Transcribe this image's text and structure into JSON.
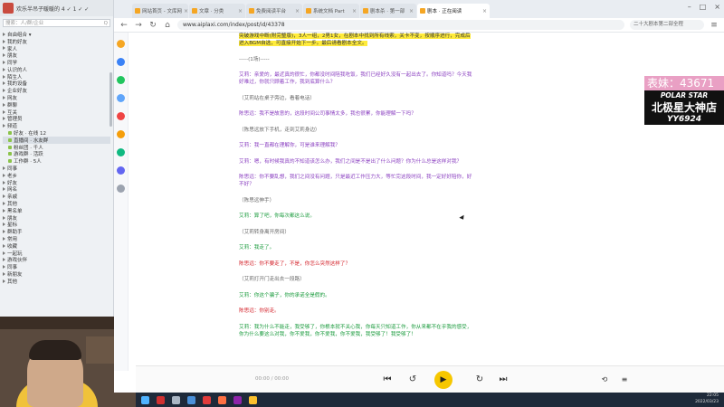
{
  "qq_panel": {
    "title": "欢乐半吊子暖暖的 4 ✓ 1 ✓ ✓",
    "search_placeholder": "搜索：人/群/企业",
    "search_scope": "Q",
    "items": [
      {
        "label": "自由组合 ▾",
        "sub": false
      },
      {
        "label": "我的好友",
        "sub": false
      },
      {
        "label": "家人",
        "sub": false
      },
      {
        "label": "朋友",
        "sub": false
      },
      {
        "label": "同学",
        "sub": false
      },
      {
        "label": "认识的人",
        "sub": false
      },
      {
        "label": "陌生人",
        "sub": false
      },
      {
        "label": "我的设备",
        "sub": false
      },
      {
        "label": "企业好友",
        "sub": false
      },
      {
        "label": "网友",
        "sub": false
      },
      {
        "label": "群聊",
        "sub": false
      },
      {
        "label": "互关",
        "sub": false
      },
      {
        "label": "管理员",
        "sub": false
      },
      {
        "label": "频道",
        "sub": false
      },
      {
        "label": "好友 · 在线 12",
        "sub": true,
        "sel": false
      },
      {
        "label": "直播间 · 水友群",
        "sub": true,
        "sel": true
      },
      {
        "label": "粉丝团 · 千人",
        "sub": true,
        "sel": false
      },
      {
        "label": "游戏群 · 活跃",
        "sub": true,
        "sel": false
      },
      {
        "label": "工作群 · 5人",
        "sub": true,
        "sel": false
      },
      {
        "label": "同事",
        "sub": false
      },
      {
        "label": "老乡",
        "sub": false
      },
      {
        "label": "好友",
        "sub": false
      },
      {
        "label": "网名",
        "sub": false
      },
      {
        "label": "亲戚",
        "sub": false
      },
      {
        "label": "其他",
        "sub": false
      },
      {
        "label": "黑名单",
        "sub": false
      },
      {
        "label": "朋友",
        "sub": false
      },
      {
        "label": "星标",
        "sub": false
      },
      {
        "label": "群助手",
        "sub": false
      },
      {
        "label": "常用",
        "sub": false
      },
      {
        "label": "收藏",
        "sub": false
      },
      {
        "label": "一起玩",
        "sub": false
      },
      {
        "label": "游戏伙伴",
        "sub": false
      },
      {
        "label": "同事",
        "sub": false
      },
      {
        "label": "新朋友",
        "sub": false
      },
      {
        "label": "其他",
        "sub": false
      }
    ]
  },
  "browser": {
    "tabs": [
      {
        "label": "网站首页 - 文库网",
        "active": false
      },
      {
        "label": "文章 · 分类",
        "active": false
      },
      {
        "label": "免费阅读平台",
        "active": false
      },
      {
        "label": "系统文档 Part",
        "active": false
      },
      {
        "label": "剧本杀 · 第一部",
        "active": false
      },
      {
        "label": "剧本 · 正在阅读",
        "active": true
      }
    ],
    "address": "www.aiplaxi.com/index/post/id/43378",
    "search_text": "二十大剧本第二部全程"
  },
  "content": [
    {
      "cls": "hl",
      "text": "突破游戏中断(附完整版)，3人一组，2男1女，在剧本中找到所有线索，关卡不变，按顺序进行，完成后进入BGM自选，可直接开始下一步。最后请看剧本全文。"
    },
    {
      "cls": "gray",
      "text": "-----(1场)-----"
    },
    {
      "cls": "purple",
      "text": "艾莉：亲爱的，最近真的很忙，你都没时间陪我吃饭，我们已经好久没有一起出去了。你知道吗？今天我好难过，你就只顾着工作，我到底算什么？"
    },
    {
      "cls": "gray",
      "text": "（艾莉站在桌子旁边，看着电话）"
    },
    {
      "cls": "purple",
      "text": "陈思远：我不是故意的，这段时间公司事情太多，我也很累，你能理解一下吗？"
    },
    {
      "cls": "gray",
      "text": "（陈思远放下手机，走到艾莉身边）"
    },
    {
      "cls": "purple",
      "text": "艾莉：我一直都在理解你，可是谁来理解我？"
    },
    {
      "cls": "purple",
      "text": "艾莉：嗯，有时候我真的不知道该怎么办，我们之间是不是出了什么问题？你为什么总是这样对我？"
    },
    {
      "cls": "purple",
      "text": "陈思远：你不要乱想，我们之间没有问题，只是最近工作压力大，等忙完这段时间，我一定好好陪你，好不好？"
    },
    {
      "cls": "gray",
      "text": "（陈思远伸手）"
    },
    {
      "cls": "green",
      "text": "艾莉：算了吧，你每次都这么说。"
    },
    {
      "cls": "gray",
      "text": "（艾莉转身离开房间）"
    },
    {
      "cls": "green",
      "text": "艾莉：我走了。"
    },
    {
      "cls": "red",
      "text": "陈思远：你不要走了，不是，你怎么突然这样了？"
    },
    {
      "cls": "gray",
      "text": "（艾莉打开门走出去一段路）"
    },
    {
      "cls": "green",
      "text": "艾莉：你这个骗子，你的承诺全是假的。"
    },
    {
      "cls": "red",
      "text": "陈思远：你别走。"
    },
    {
      "cls": "green",
      "text": "艾莉：我为什么不能走，我受够了，你根本就不关心我，你每天只知道工作，你从来都不在乎我的感受，你为什么要这么对我，你不爱我，你不爱我，你不爱我，我受够了！我受够了！"
    }
  ],
  "overlay": {
    "count": "表妹：43671",
    "line1": "POLAR STAR",
    "line2": "北极星大神店",
    "line3": "YY6924"
  },
  "player": {
    "time": "00:00 / 00:00",
    "prev_icon": "prev-icon",
    "play_icon": "play-icon",
    "next_icon": "next-icon"
  },
  "taskbar": {
    "time": "22:05",
    "date": "2022/03/23"
  },
  "colors": {
    "highlight": "#ffeb3b",
    "play_button": "#f6c700",
    "overlay_pink": "#e9a0c4"
  }
}
